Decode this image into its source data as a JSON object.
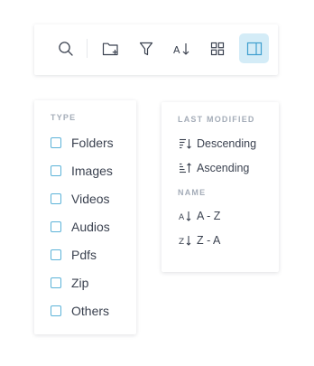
{
  "toolbar": {
    "buttons": [
      {
        "icon": "search-icon",
        "active": false
      },
      {
        "icon": "new-folder-icon",
        "active": false
      },
      {
        "icon": "filter-icon",
        "active": false
      },
      {
        "icon": "sort-az-icon",
        "active": false
      },
      {
        "icon": "grid-view-icon",
        "active": false
      },
      {
        "icon": "side-panel-icon",
        "active": true
      }
    ],
    "accent_color": "#d4ecf7",
    "icon_color": "#3b4250"
  },
  "type_filter": {
    "title": "TYPE",
    "options": [
      {
        "label": "Folders",
        "checked": false
      },
      {
        "label": "Images",
        "checked": false
      },
      {
        "label": "Videos",
        "checked": false
      },
      {
        "label": "Audios",
        "checked": false
      },
      {
        "label": "Pdfs",
        "checked": false
      },
      {
        "label": "Zip",
        "checked": false
      },
      {
        "label": "Others",
        "checked": false
      }
    ],
    "checkbox_color": "#5cb3d8"
  },
  "sort": {
    "last_modified_title": "LAST MODIFIED",
    "last_modified_options": [
      {
        "label": "Descending",
        "icon": "sort-descending-icon"
      },
      {
        "label": "Ascending",
        "icon": "sort-ascending-icon"
      }
    ],
    "name_title": "NAME",
    "name_options": [
      {
        "label": "A - Z",
        "icon": "sort-a-z-icon"
      },
      {
        "label": "Z - A",
        "icon": "sort-z-a-icon"
      }
    ]
  }
}
